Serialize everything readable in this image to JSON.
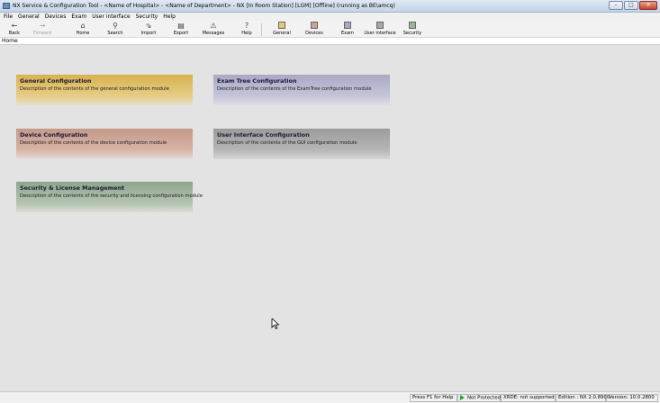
{
  "window": {
    "title": "NX Service & Configuration Tool - <Name of Hospital> - <Name of Department> - NX [In Room Station] [LGM] [Offline] (running as BE\\amcq)",
    "controls": [
      "–",
      "□",
      "✕"
    ]
  },
  "menu": [
    "File",
    "General",
    "Devices",
    "Exam",
    "User interface",
    "Security",
    "Help"
  ],
  "toolbar": {
    "back": "Back",
    "forward": "Forward",
    "home": "Home",
    "search": "Search",
    "import": "Import",
    "export": "Export",
    "messages": "Messages",
    "help": "Help",
    "general": "General",
    "devices": "Devices",
    "exam": "Exam",
    "user_interface": "User interface",
    "security": "Security"
  },
  "icons": {
    "back": "←",
    "forward": "→",
    "home": "⌂",
    "search": "⚲",
    "import": "⇘",
    "export": "▤",
    "messages": "⚠",
    "help": "?"
  },
  "breadcrumb": "Home",
  "cards": {
    "general": {
      "title": "General Configuration",
      "desc": "Description of the contents of the general configuration module"
    },
    "examtree": {
      "title": "Exam Tree Configuration",
      "desc": "Description of the contents of the ExamTree configuration module"
    },
    "device": {
      "title": "Device Configuration",
      "desc": "Description of the contents of the device configuration module"
    },
    "ui": {
      "title": "User Interface Configuration",
      "desc": "Description of the contents of the GUI configuration module"
    },
    "security": {
      "title": "Security & License Management",
      "desc": "Description of the contents of the security and licensing configuration module"
    }
  },
  "status": {
    "help": "Press F1 for Help",
    "protection": "Not Protected",
    "xrde": "XRDE: not supported",
    "edition": "Edition : NX 2.0.8900",
    "version": "Version: 10.0.2800"
  },
  "colors": {
    "general": "#d8b24e",
    "examtree": "#a9a9c7",
    "device": "#c49989",
    "ui": "#9b9b9b",
    "security": "#8ea58c",
    "protection": "#2aa02a"
  }
}
